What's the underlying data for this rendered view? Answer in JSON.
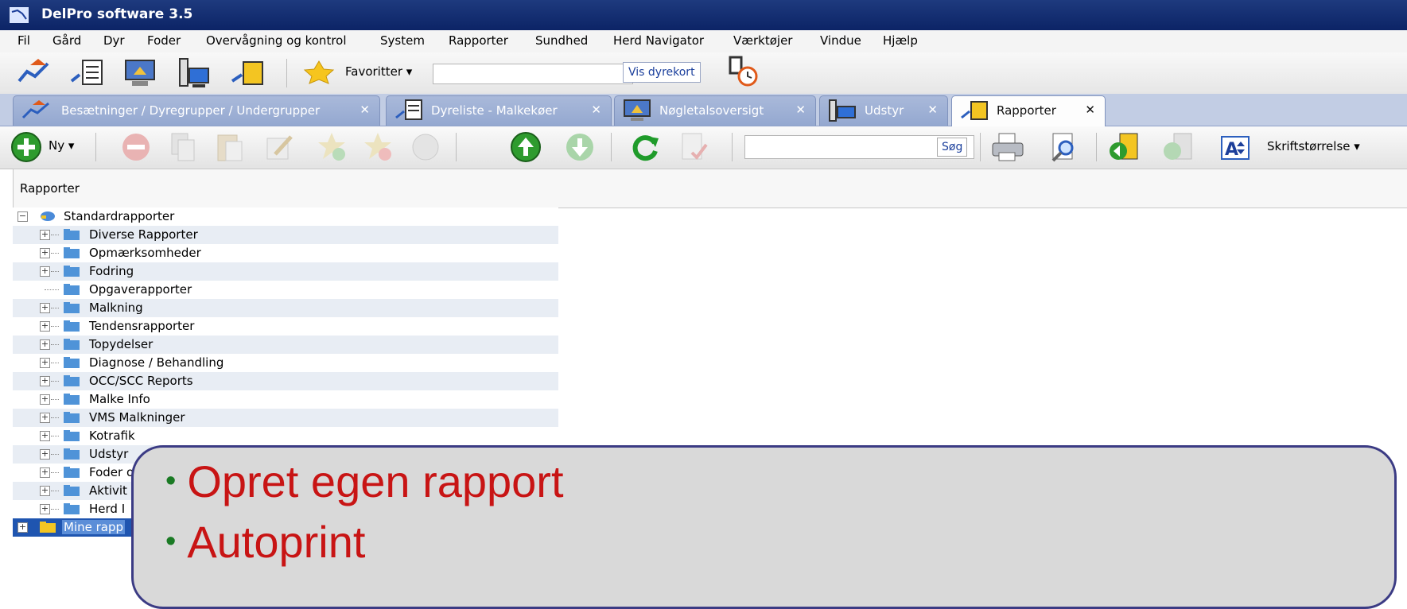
{
  "window": {
    "title": "DelPro software 3.5"
  },
  "menu": [
    "Fil",
    "Gård",
    "Dyr",
    "Foder",
    "Overvågning og kontrol",
    "System",
    "Rapporter",
    "Sundhed",
    "Herd Navigator",
    "Værktøjer",
    "Vindue",
    "Hjælp"
  ],
  "quickbar": {
    "favorites_label": "Favoritter ▾",
    "search_value": "",
    "vis_dyrekort": "Vis dyrekort"
  },
  "tabs": [
    {
      "label": "Besætninger / Dyregrupper / Undergrupper",
      "close": "✕"
    },
    {
      "label": "Dyreliste - Malkekøer",
      "close": "✕"
    },
    {
      "label": "Nøgletalsoversigt",
      "close": "✕"
    },
    {
      "label": "Udstyr",
      "close": "✕"
    },
    {
      "label": "Rapporter",
      "close": "✕"
    }
  ],
  "toolbar": {
    "new_label": "Ny ▾",
    "search_button": "Søg",
    "search_value": "",
    "font_size_label": "Skriftstørrelse ▾"
  },
  "panel": {
    "header": "Rapporter"
  },
  "tree": [
    {
      "label": "Standardrapporter",
      "expander": "⊟"
    },
    {
      "label": "Diverse Rapporter",
      "expander": "⊞"
    },
    {
      "label": "Opmærksomheder",
      "expander": "⊞"
    },
    {
      "label": "Fodring",
      "expander": "⊞"
    },
    {
      "label": "Opgaverapporter",
      "expander": ""
    },
    {
      "label": "Malkning",
      "expander": "⊞"
    },
    {
      "label": "Tendensrapporter",
      "expander": "⊞"
    },
    {
      "label": "Topydelser",
      "expander": "⊞"
    },
    {
      "label": "Diagnose / Behandling",
      "expander": "⊞"
    },
    {
      "label": "OCC/SCC Reports",
      "expander": "⊞"
    },
    {
      "label": "Malke Info",
      "expander": "⊞"
    },
    {
      "label": "VMS Malkninger",
      "expander": "⊞"
    },
    {
      "label": "Kotrafik",
      "expander": "⊞"
    },
    {
      "label": "Udstyr",
      "expander": "⊞"
    },
    {
      "label": "Foder o",
      "expander": "⊞"
    },
    {
      "label": "Aktivit",
      "expander": "⊞"
    },
    {
      "label": "Herd I",
      "expander": "⊞"
    },
    {
      "label": "Mine rapp",
      "expander": "⊞"
    }
  ],
  "callout": {
    "bullets": [
      "Opret egen rapport",
      "Autoprint"
    ]
  }
}
